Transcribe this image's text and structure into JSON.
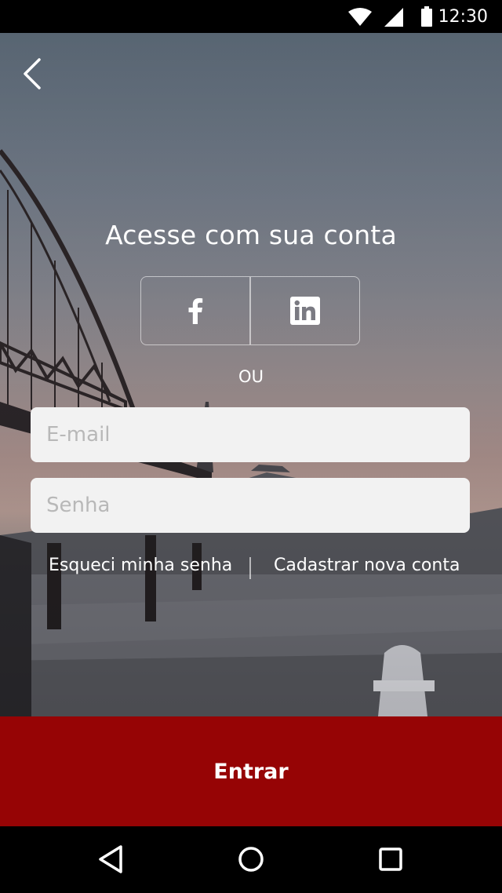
{
  "status_bar": {
    "time": "12:30"
  },
  "login": {
    "title": "Acesse com sua conta",
    "or_label": "OU",
    "email_placeholder": "E-mail",
    "email_value": "",
    "password_placeholder": "Senha",
    "password_value": "",
    "forgot_password": "Esqueci minha senha",
    "register": "Cadastrar nova conta",
    "submit_label": "Entrar"
  },
  "social": [
    {
      "icon": "facebook-icon"
    },
    {
      "icon": "linkedin-icon"
    }
  ],
  "nav": [
    {
      "icon": "back-triangle-icon"
    },
    {
      "icon": "home-circle-icon"
    },
    {
      "icon": "recents-square-icon"
    }
  ],
  "colors": {
    "primary_button": "#960405",
    "field_background": "#f2f2f2",
    "text_on_dark": "#ffffff"
  }
}
